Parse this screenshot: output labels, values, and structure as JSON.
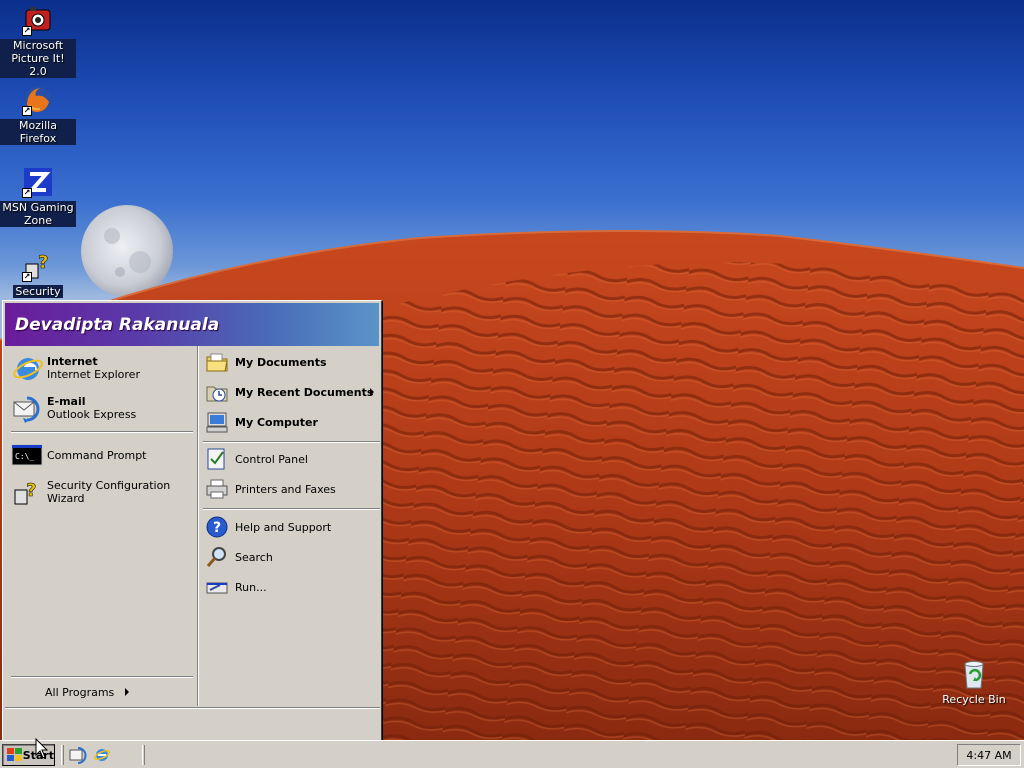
{
  "desktop": {
    "icons": [
      {
        "label_line1": "Microsoft",
        "label_line2": "Picture It! 2.0"
      },
      {
        "label_line1": "Mozilla Firefox",
        "label_line2": ""
      },
      {
        "label_line1": "MSN Gaming",
        "label_line2": "Zone"
      },
      {
        "label_line1": "Security",
        "label_line2": ""
      },
      {
        "label_line1": "Recycle Bin",
        "label_line2": ""
      }
    ]
  },
  "start_menu": {
    "user_name": "Devadipta Rakanuala",
    "pinned": [
      {
        "title": "Internet",
        "subtitle": "Internet Explorer",
        "icon": "internet-explorer-icon"
      },
      {
        "title": "E-mail",
        "subtitle": "Outlook Express",
        "icon": "outlook-express-icon"
      }
    ],
    "recent": [
      {
        "label": "Command Prompt",
        "icon": "command-prompt-icon"
      },
      {
        "label_line1": "Security Configuration",
        "label_line2": "Wizard",
        "icon": "security-wizard-icon"
      }
    ],
    "all_programs": "All Programs",
    "places": [
      {
        "label": "My Documents",
        "icon": "my-documents-icon"
      },
      {
        "label": "My Recent Documents",
        "icon": "recent-documents-icon"
      },
      {
        "label": "My Computer",
        "icon": "my-computer-icon"
      }
    ],
    "settings": [
      {
        "label": "Control Panel",
        "icon": "control-panel-icon"
      },
      {
        "label": "Printers and Faxes",
        "icon": "printer-icon"
      }
    ],
    "tools": [
      {
        "label": "Help and Support",
        "icon": "help-icon"
      },
      {
        "label": "Search",
        "icon": "search-icon"
      },
      {
        "label": "Run...",
        "icon": "run-icon"
      }
    ]
  },
  "taskbar": {
    "start_label": "Start",
    "clock": "4:47 AM"
  },
  "colors": {
    "header_gradient_start": "#6a1c9a",
    "header_gradient_end": "#5a94c8",
    "menu_face": "#d4d0c8",
    "desert": "#b8401c"
  }
}
